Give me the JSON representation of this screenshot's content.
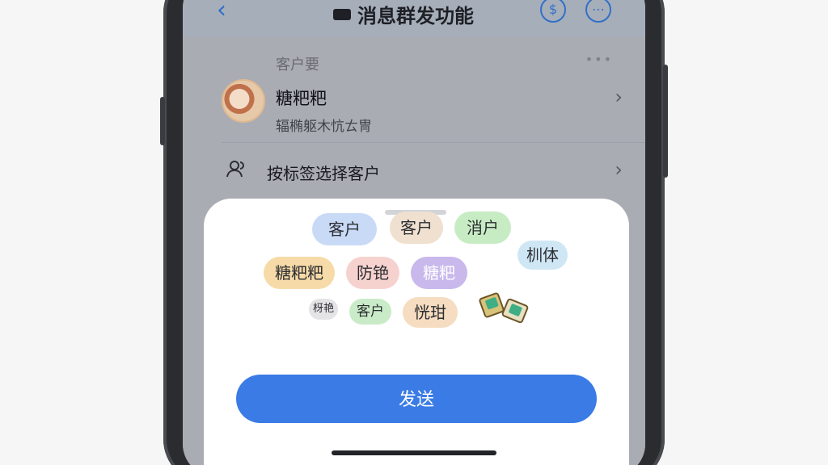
{
  "nav": {
    "back_icon": "back-chevron-icon",
    "title": "消息群发功能",
    "title_icon": "signal-icon",
    "icons": [
      "coin-icon",
      "more-circle-icon"
    ]
  },
  "section": {
    "title": "客户要",
    "more": "•••"
  },
  "contact": {
    "name": "糖粑粑",
    "subtitle": "辐椭躯木忼ㄊ冑",
    "chevron": "›"
  },
  "tag_row": {
    "icon": "people-icon",
    "label": "按标签选择客户",
    "chevron": "›"
  },
  "sheet": {
    "tags": [
      {
        "label": "客户",
        "color": "#c9daf7"
      },
      {
        "label": "客户",
        "color": "#efe0d0"
      },
      {
        "label": "消户",
        "color": "#c7ecc4"
      },
      {
        "label": "糖粑粑",
        "color": "#f6dba8"
      },
      {
        "label": "防铯",
        "color": "#f6d2cf"
      },
      {
        "label": "糖粑",
        "color": "#c9b8ec"
      },
      {
        "label": "杊体",
        "color": "#cfe6f5"
      },
      {
        "label": "枒艳",
        "color": "#e4e4e6"
      },
      {
        "label": "客户",
        "color": "#c9ebc8"
      },
      {
        "label": "恍玵",
        "color": "#f6dcc0"
      }
    ],
    "send_label": "发送"
  },
  "colors": {
    "accent": "#3b7be6",
    "nav_icon": "#3170c8"
  }
}
